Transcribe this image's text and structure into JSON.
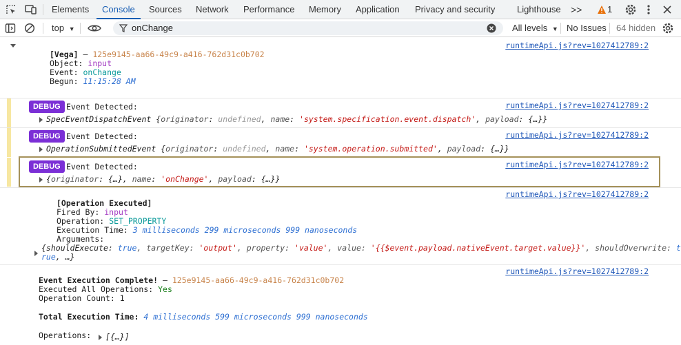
{
  "tabs": {
    "items": [
      "Elements",
      "Console",
      "Sources",
      "Network",
      "Performance",
      "Memory",
      "Application",
      "Privacy and security",
      "Lighthouse"
    ],
    "more": ">>",
    "warning_count": "1"
  },
  "toolbar": {
    "context": "top",
    "filter_value": "onChange",
    "levels": "All levels",
    "issues": "No Issues",
    "hidden": "64 hidden"
  },
  "colors": {
    "accent": "#1a5fb4",
    "debug_badge": "#7b2fd6",
    "link": "#1f57b8",
    "highlight_border": "#a5915a"
  },
  "source_link": "runtimeApi.js?rev=1027412789:2",
  "vega": {
    "title": "[Vega]",
    "dash": " – ",
    "id": "125e9145-aa66-49c9-a416-762d31c0b702",
    "object_label": "Object:",
    "object_value": "input",
    "event_label": "Event:",
    "event_value": "onChange",
    "begun_label": "Begun:",
    "begun_value": "11:15:28 AM"
  },
  "debug": {
    "badge": "DEBUG",
    "message": "Event Detected:",
    "rows": [
      {
        "prefix": "SpecEventDispatchEvent ",
        "originator_key": "originator",
        "originator_value": "undefined",
        "name_key": "name",
        "name_value": "'system.specification.event.dispatch'",
        "payload_key": "payload",
        "payload_value": "{…}"
      },
      {
        "prefix": "OperationSubmittedEvent ",
        "originator_key": "originator",
        "originator_value": "undefined",
        "name_key": "name",
        "name_value": "'system.operation.submitted'",
        "payload_key": "payload",
        "payload_value": "{…}"
      },
      {
        "prefix": "",
        "originator_key": "originator",
        "originator_value": "{…}",
        "name_key": "name",
        "name_value": "'onChange'",
        "payload_key": "payload",
        "payload_value": "{…}"
      }
    ]
  },
  "operation": {
    "title": "[Operation Executed]",
    "fired_label": "Fired By:",
    "fired_value": "input",
    "op_label": "Operation:",
    "op_value": "SET_PROPERTY",
    "time_label": "Execution Time:",
    "time_value": "3 milliseconds 299 microseconds 999 nanoseconds",
    "args_label": "Arguments:",
    "args_line1_a": "{shouldExecute: ",
    "args_line1_b": "true",
    "args_line1_c": ", targetKey: ",
    "args_line1_d": "'output'",
    "args_line1_e": ", property: ",
    "args_line1_f": "'value'",
    "args_line1_g": ", value: ",
    "args_line1_h": "'{{$event.payload.nativeEvent.target.value}}'",
    "args_line1_i": ", shouldOverwrite: ",
    "args_line1_j": "t",
    "args_line2_a": "rue",
    "args_line2_b": ", …}"
  },
  "complete": {
    "title": "Event Execution Complete!",
    "dash": " – ",
    "id": "125e9145-aa66-49c9-a416-762d31c0b702",
    "all_label": "Executed All Operations:",
    "all_value": "Yes",
    "count_label": "Operation Count:",
    "count_value": "1",
    "total_label": "Total Execution Time:",
    "total_value": "4 milliseconds 599 microseconds 999 nanoseconds",
    "ops_label": "Operations:",
    "ops_value": "[{…}]"
  }
}
